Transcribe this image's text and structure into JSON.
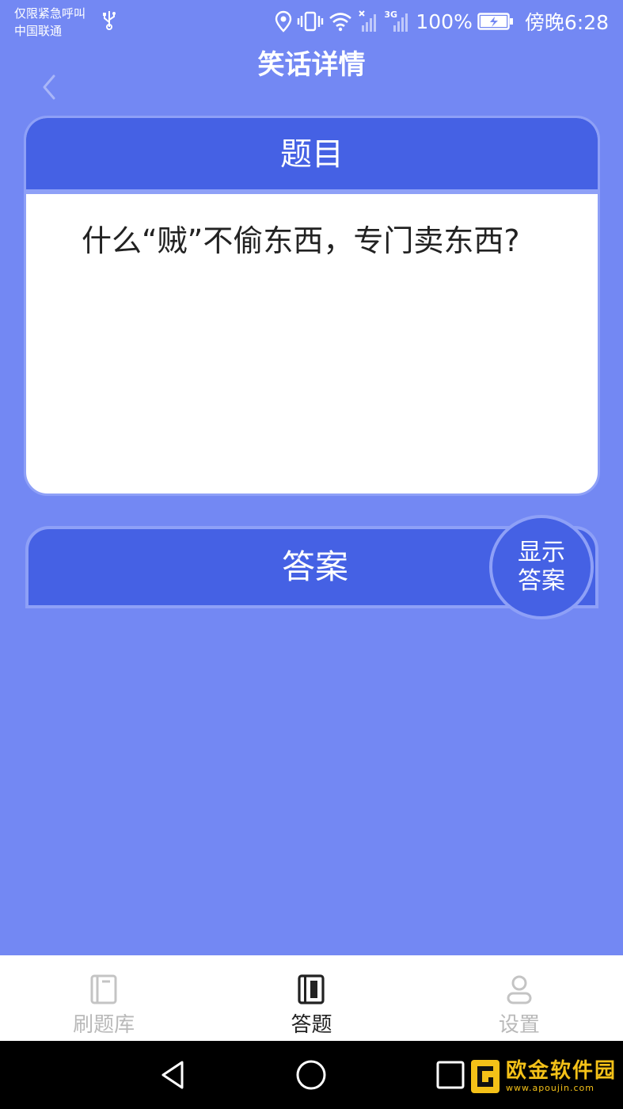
{
  "status_bar": {
    "carrier_line1": "仅限紧急呼叫",
    "carrier_line2": "中国联通",
    "network_label": "3G",
    "battery_percent": "100%",
    "time": "傍晚6:28"
  },
  "header": {
    "title": "笑话详情"
  },
  "question": {
    "header_label": "题目",
    "text": "什么“贼”不偷东西，专门卖东西?"
  },
  "answer": {
    "header_label": "答案",
    "show_button_line1": "显示",
    "show_button_line2": "答案"
  },
  "bottom_nav": {
    "tabs": [
      {
        "label": "刷题库",
        "icon": "book-icon",
        "active": false
      },
      {
        "label": "答题",
        "icon": "notebook-icon",
        "active": true
      },
      {
        "label": "设置",
        "icon": "user-icon",
        "active": false
      }
    ]
  },
  "watermark": {
    "title": "欧金软件园",
    "url": "www.apoujin.com"
  },
  "colors": {
    "background": "#7388F3",
    "card_header": "#4561E4",
    "card_border": "#8ea0f7",
    "nav_active": "#222222",
    "nav_inactive": "#b9b9b9"
  }
}
